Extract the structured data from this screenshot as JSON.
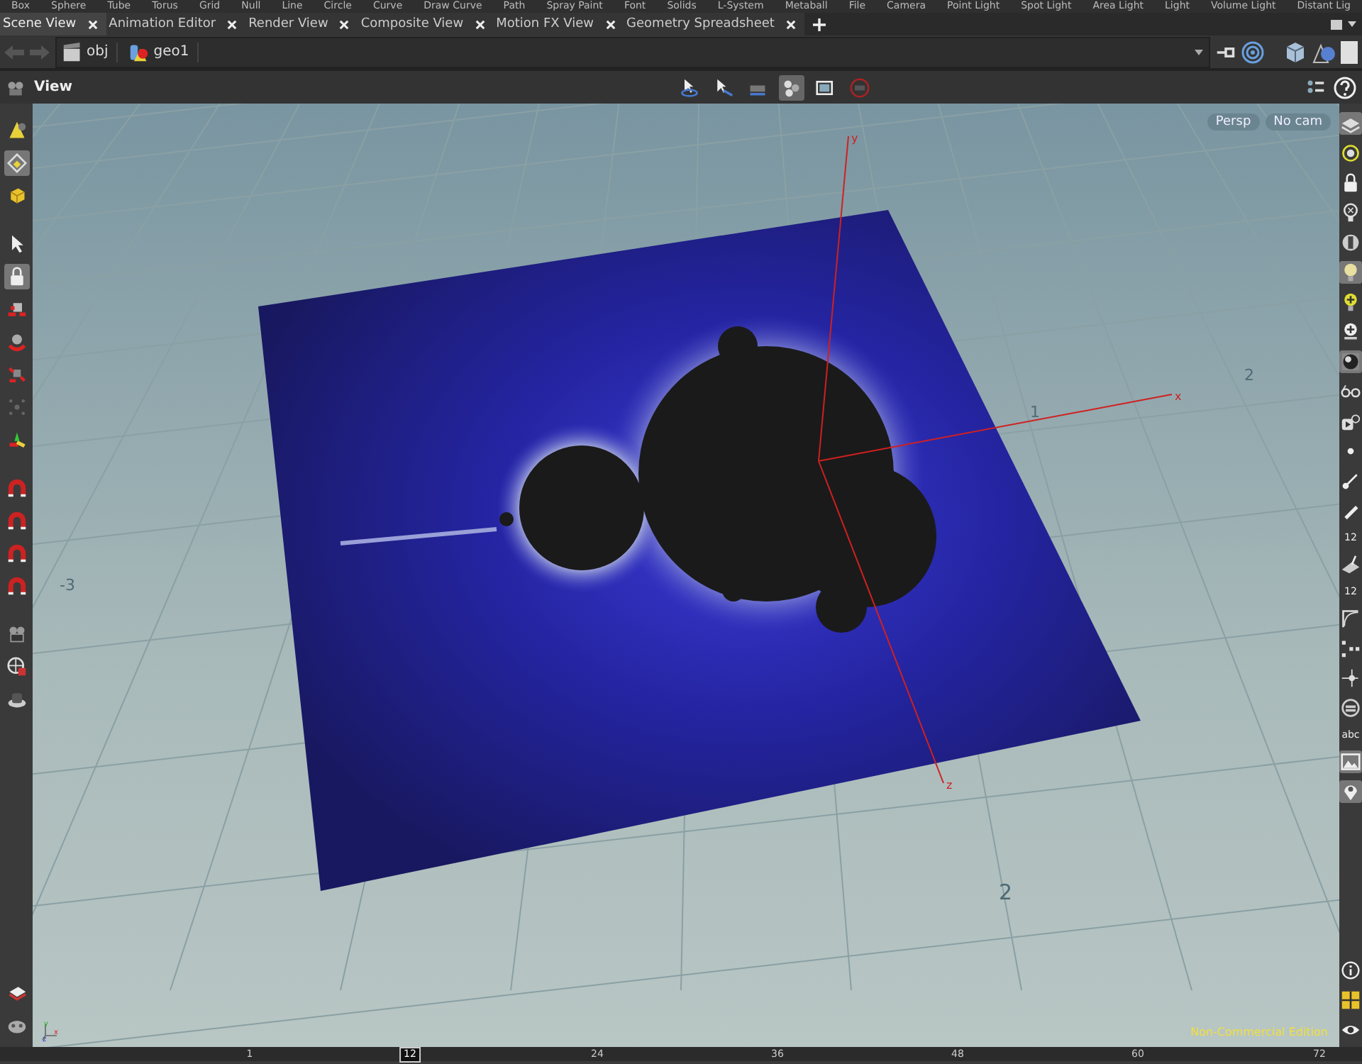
{
  "shelf": {
    "tools": [
      "Box",
      "Sphere",
      "Tube",
      "Torus",
      "Grid",
      "Null",
      "Line",
      "Circle",
      "Curve",
      "Draw Curve",
      "Path",
      "Spray Paint",
      "Font",
      "Solids",
      "L-System",
      "Metaball",
      "File"
    ],
    "lights": [
      "Camera",
      "Point Light",
      "Spot Light",
      "Area Light",
      "Light",
      "Volume Light",
      "Distant Lig"
    ]
  },
  "tabs": [
    {
      "label": "Scene View",
      "selected": true
    },
    {
      "label": "Animation Editor",
      "selected": false
    },
    {
      "label": "Render View",
      "selected": false
    },
    {
      "label": "Composite View",
      "selected": false
    },
    {
      "label": "Motion FX View",
      "selected": false
    },
    {
      "label": "Geometry Spreadsheet",
      "selected": false
    }
  ],
  "path": [
    "obj",
    "geo1"
  ],
  "viewer": {
    "title": "View",
    "toolbar": [
      {
        "selected": false
      },
      {
        "selected": false
      },
      {
        "selected": false
      },
      {
        "selected": true
      },
      {
        "selected": false
      },
      {
        "selected": false
      }
    ]
  },
  "left_toolbar": [
    {
      "selected": false
    },
    {
      "selected": true
    },
    {
      "selected": false
    },
    {
      "selected": false
    },
    {
      "selected": true
    },
    {
      "selected": false
    },
    {
      "selected": false
    },
    {
      "selected": false
    },
    {
      "selected": false
    },
    {
      "selected": false
    },
    {
      "selected": false
    },
    {
      "selected": false
    },
    {
      "selected": false
    },
    {
      "selected": false
    },
    {
      "selected": false
    },
    {
      "selected": false
    },
    {
      "selected": false
    }
  ],
  "right_toolbar": {
    "point_number_label": "12",
    "primitive_number_label": "12",
    "text_label": "abc"
  },
  "viewport": {
    "camera_menu": "Persp",
    "view_menu": "No cam",
    "axis_labels": [
      "y",
      "x",
      "z"
    ],
    "grid_labels": [
      "1",
      "2",
      "-3",
      "2"
    ],
    "gizmo_labels": [
      "y",
      "x",
      "z"
    ],
    "edition_label": "Non-Commercial Edition"
  },
  "timeline": {
    "ticks": [
      "1",
      "24",
      "36",
      "48",
      "60",
      "72"
    ],
    "current_frame": "12"
  }
}
